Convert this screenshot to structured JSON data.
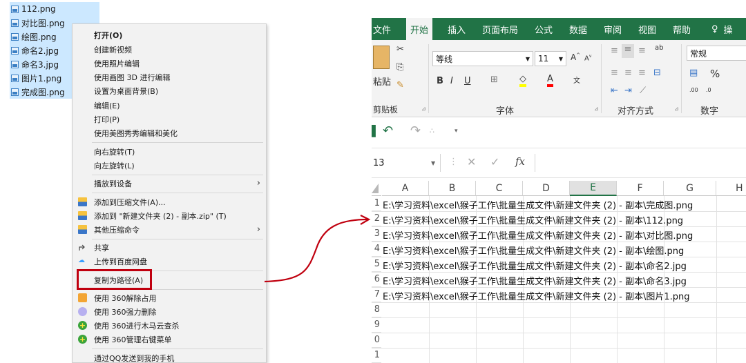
{
  "files": [
    "112.png",
    "对比图.png",
    "绘图.png",
    "命名2.jpg",
    "命名3.jpg",
    "图片1.png",
    "完成图.png"
  ],
  "menu": {
    "items": [
      {
        "label": "打开(O)",
        "bold": true
      },
      {
        "label": "创建新视频"
      },
      {
        "label": "使用照片编辑"
      },
      {
        "label": "使用画图 3D 进行编辑"
      },
      {
        "label": "设置为桌面背景(B)"
      },
      {
        "label": "编辑(E)"
      },
      {
        "label": "打印(P)"
      },
      {
        "label": "使用美图秀秀编辑和美化"
      },
      {
        "label": "向右旋转(T)"
      },
      {
        "label": "向左旋转(L)"
      },
      {
        "label": "播放到设备"
      },
      {
        "label": "添加到压缩文件(A)..."
      },
      {
        "label": "添加到 \"新建文件夹 (2) - 副本.zip\" (T)"
      },
      {
        "label": "其他压缩命令"
      },
      {
        "label": "共享"
      },
      {
        "label": "上传到百度网盘"
      },
      {
        "label": "复制为路径(A)"
      },
      {
        "label": "使用 360解除占用"
      },
      {
        "label": "使用 360强力删除"
      },
      {
        "label": "使用 360进行木马云查杀"
      },
      {
        "label": "使用 360管理右键菜单"
      },
      {
        "label": "通过QQ发送到我的手机"
      }
    ]
  },
  "excel": {
    "tabs": [
      "文件",
      "开始",
      "插入",
      "页面布局",
      "公式",
      "数据",
      "审阅",
      "视图",
      "帮助",
      "操"
    ],
    "ribbon": {
      "paste": "粘贴",
      "clipboard": "剪贴板",
      "font_name": "等线",
      "font_size": "11",
      "font_group": "字体",
      "align_group": "对齐方式",
      "number_format": "常规",
      "number_group": "数字"
    },
    "name_box": "13",
    "fx": "fx",
    "columns": [
      "A",
      "B",
      "C",
      "D",
      "E",
      "F",
      "G",
      "H"
    ],
    "row_numbers": [
      "1",
      "2",
      "3",
      "4",
      "5",
      "6",
      "7",
      "8",
      "9",
      "0",
      "1"
    ],
    "rows": [
      "E:\\学习资料\\excel\\猴子工作\\批量生成文件\\新建文件夹 (2) - 副本\\完成图.png",
      "E:\\学习资料\\excel\\猴子工作\\批量生成文件\\新建文件夹 (2) - 副本\\112.png",
      "E:\\学习资料\\excel\\猴子工作\\批量生成文件\\新建文件夹 (2) - 副本\\对比图.png",
      "E:\\学习资料\\excel\\猴子工作\\批量生成文件\\新建文件夹 (2) - 副本\\绘图.png",
      "E:\\学习资料\\excel\\猴子工作\\批量生成文件\\新建文件夹 (2) - 副本\\命名2.jpg",
      "E:\\学习资料\\excel\\猴子工作\\批量生成文件\\新建文件夹 (2) - 副本\\命名3.jpg",
      "E:\\学习资料\\excel\\猴子工作\\批量生成文件\\新建文件夹 (2) - 副本\\图片1.png"
    ]
  },
  "colors": {
    "excel_green": "#217346",
    "selection_blue": "#cce8ff",
    "highlight_red": "#c0000f"
  }
}
